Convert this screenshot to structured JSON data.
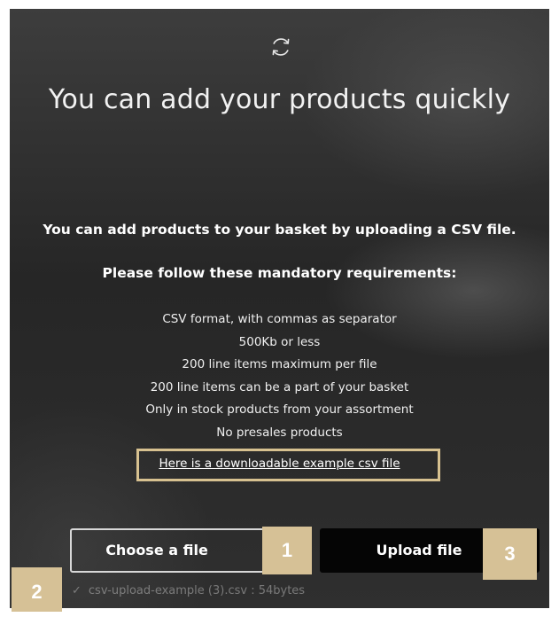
{
  "dialog": {
    "refresh_icon": "refresh-icon",
    "title": "You can add your products quickly",
    "intro": "You can add products to your basket by uploading a CSV file.",
    "requirements_title": "Please follow these mandatory requirements:",
    "requirements": [
      "CSV format, with commas as separator",
      "500Kb or less",
      "200 line items maximum per file",
      "200 line items can be a part of your basket",
      "Only in stock products from your assortment",
      "No presales products"
    ],
    "example_link": "Here is a downloadable example csv file",
    "choose_button": "Choose a file",
    "upload_button": "Upload file",
    "file_status": {
      "check_icon": "check-icon",
      "check": "✓",
      "text": "csv-upload-example (3).csv : 54bytes"
    }
  },
  "annotations": {
    "badge_1": "1",
    "badge_2": "2",
    "badge_3": "3",
    "accent_color": "#d6c196"
  }
}
